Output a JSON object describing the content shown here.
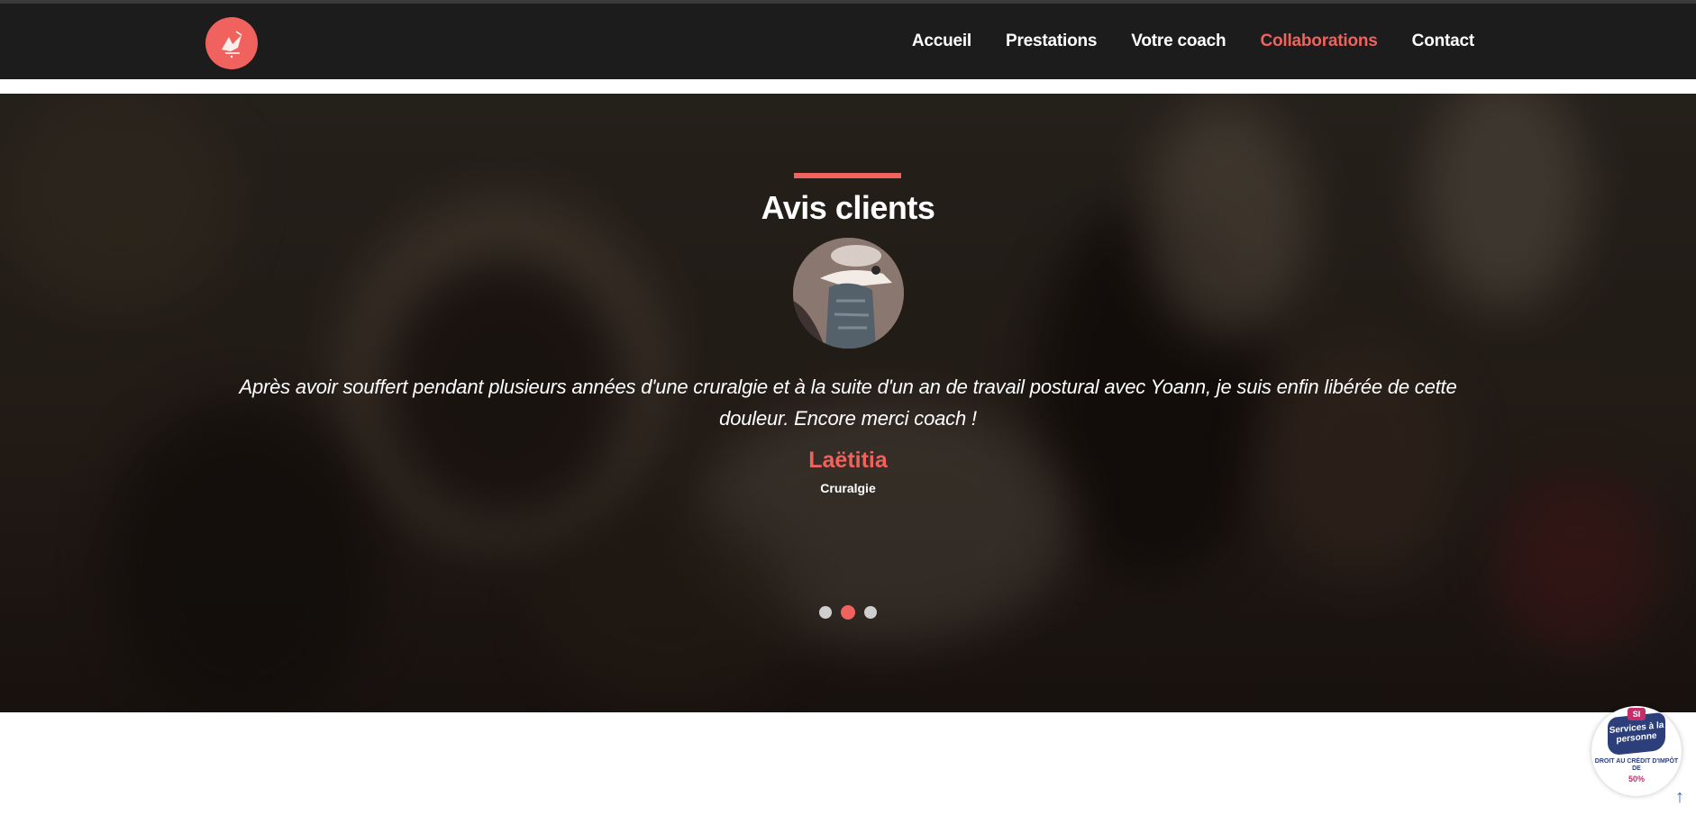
{
  "navbar": {
    "logo": {
      "icon": "bird-logo-icon",
      "bg_color": "#f0625d"
    },
    "items": [
      {
        "label": "Accueil",
        "active": false
      },
      {
        "label": "Prestations",
        "active": false
      },
      {
        "label": "Votre coach",
        "active": false
      },
      {
        "label": "Collaborations",
        "active": true
      },
      {
        "label": "Contact",
        "active": false
      }
    ]
  },
  "testimonials": {
    "title": "Avis clients",
    "quote": "Après avoir souffert pendant plusieurs années d'une cruralgie et à la suite d'un an de travail postural avec Yoann, je suis enfin libérée de cette douleur. Encore merci coach !",
    "name": "Laëtitia",
    "role": "Cruralgie",
    "carousel": {
      "count": 3,
      "active_index": 1
    }
  },
  "badge": {
    "si": "SI",
    "title": "Services à la personne",
    "text": "DROIT AU CRÉDIT D'IMPÔT DE",
    "percent": "50%"
  },
  "colors": {
    "accent": "#f0625d",
    "navbar_bg": "#1c1c1c",
    "badge_blue": "#2d3f7a",
    "badge_pink": "#c42f6b"
  },
  "icons": {
    "scroll_top": "arrow-up-icon"
  }
}
